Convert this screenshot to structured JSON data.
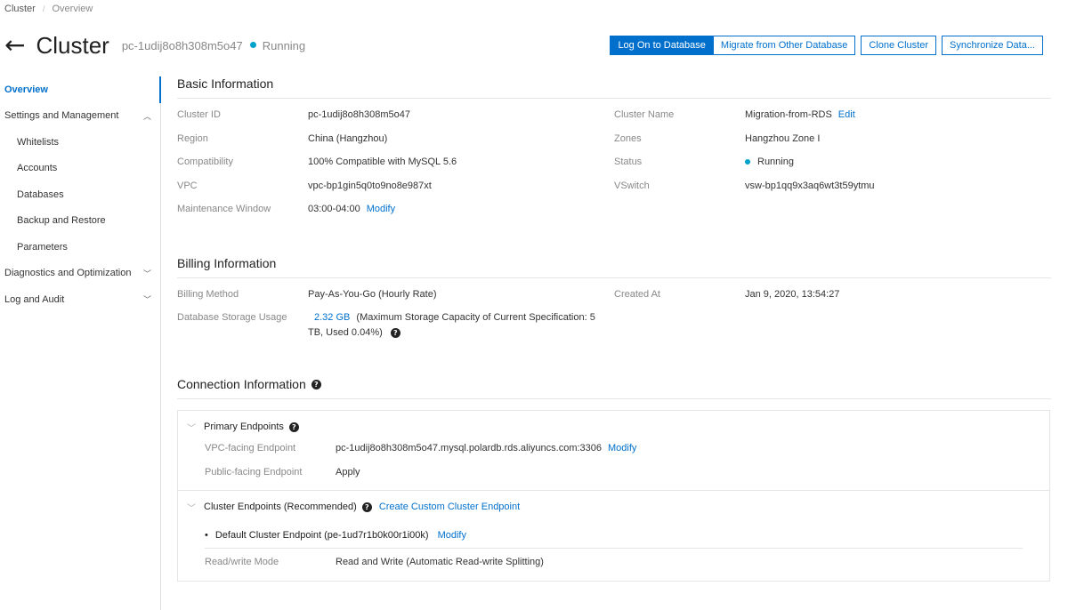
{
  "breadcrumb": {
    "root": "Cluster",
    "current": "Overview"
  },
  "header": {
    "title": "Cluster",
    "cluster_id": "pc-1udij8o8h308m5o47",
    "status": "Running"
  },
  "actions": {
    "log_on": "Log On to Database",
    "migrate": "Migrate from Other Database",
    "clone": "Clone Cluster",
    "sync": "Synchronize Data..."
  },
  "sidebar": {
    "overview": "Overview",
    "settings": "Settings and Management",
    "whitelists": "Whitelists",
    "accounts": "Accounts",
    "databases": "Databases",
    "backup": "Backup and Restore",
    "parameters": "Parameters",
    "diagnostics": "Diagnostics and Optimization",
    "log_audit": "Log and Audit"
  },
  "basic": {
    "title": "Basic Information",
    "cluster_id_label": "Cluster ID",
    "cluster_id": "pc-1udij8o8h308m5o47",
    "cluster_name_label": "Cluster Name",
    "cluster_name": "Migration-from-RDS",
    "edit": "Edit",
    "region_label": "Region",
    "region": "China (Hangzhou)",
    "zones_label": "Zones",
    "zones": "Hangzhou Zone I",
    "compat_label": "Compatibility",
    "compat": "100% Compatible with MySQL 5.6",
    "status_label": "Status",
    "status": "Running",
    "vpc_label": "VPC",
    "vpc": "vpc-bp1gin5q0to9no8e987xt",
    "vswitch_label": "VSwitch",
    "vswitch": "vsw-bp1qq9x3aq6wt3t59ytmu",
    "maint_label": "Maintenance Window",
    "maint": "03:00-04:00",
    "modify": "Modify"
  },
  "billing": {
    "title": "Billing Information",
    "method_label": "Billing Method",
    "method": "Pay-As-You-Go (Hourly Rate)",
    "created_label": "Created At",
    "created": "Jan 9, 2020, 13:54:27",
    "storage_label": "Database Storage Usage",
    "storage_value": "2.32 GB",
    "storage_note_1": "(Maximum Storage Capacity of Current Specification: 5",
    "storage_note_2": "TB, Used 0.04%)"
  },
  "connection": {
    "title": "Connection Information",
    "primary_title": "Primary Endpoints",
    "vpc_ep_label": "VPC-facing Endpoint",
    "vpc_ep": "pc-1udij8o8h308m5o47.mysql.polardb.rds.aliyuncs.com:3306",
    "modify": "Modify",
    "public_ep_label": "Public-facing Endpoint",
    "apply": "Apply",
    "cluster_title": "Cluster Endpoints (Recommended)",
    "create_custom": "Create Custom Cluster Endpoint",
    "default_ep": "Default Cluster Endpoint (pe-1ud7r1b0k00r1i00k)",
    "modify2": "Modify",
    "rw_label": "Read/write Mode",
    "rw": "Read and Write (Automatic Read-write Splitting)"
  },
  "colors": {
    "accent": "#0070cc",
    "status_dot": "#00a2ca"
  }
}
